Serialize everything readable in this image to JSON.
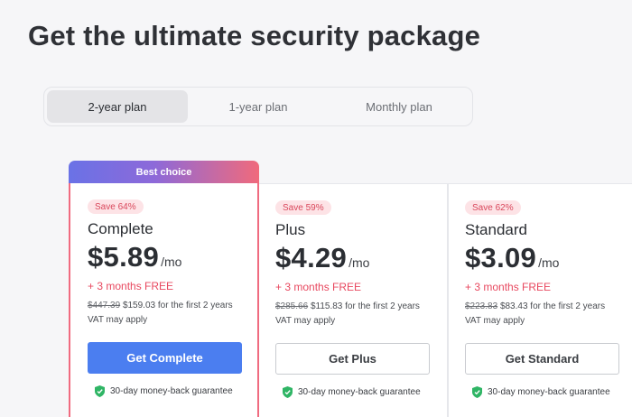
{
  "page": {
    "title": "Get the ultimate security package"
  },
  "plan_tabs": [
    {
      "label": "2-year plan",
      "active": true
    },
    {
      "label": "1-year plan",
      "active": false
    },
    {
      "label": "Monthly plan",
      "active": false
    }
  ],
  "cards": [
    {
      "banner": "Best choice",
      "save": "Save 64%",
      "name": "Complete",
      "price": "$5.89",
      "per": "/mo",
      "free": "+ 3 months FREE",
      "old_price": "$447.39",
      "new_price": "$159.03",
      "billing_suffix": " for the first 2 years",
      "vat": "VAT may apply",
      "cta": "Get Complete",
      "guarantee": "30-day money-back guarantee"
    },
    {
      "save": "Save 59%",
      "name": "Plus",
      "price": "$4.29",
      "per": "/mo",
      "free": "+ 3 months FREE",
      "old_price": "$285.66",
      "new_price": "$115.83",
      "billing_suffix": " for the first 2 years",
      "vat": "VAT may apply",
      "cta": "Get Plus",
      "guarantee": "30-day money-back guarantee"
    },
    {
      "save": "Save 62%",
      "name": "Standard",
      "price": "$3.09",
      "per": "/mo",
      "free": "+ 3 months FREE",
      "old_price": "$223.83",
      "new_price": "$83.43",
      "billing_suffix": " for the first 2 years",
      "vat": "VAT may apply",
      "cta": "Get Standard",
      "guarantee": "30-day money-back guarantee"
    }
  ],
  "colors": {
    "accent_blue": "#4b7ef0",
    "sale_red": "#e8485f",
    "badge_bg": "#fde3e6",
    "featured_border": "#f06b80",
    "shield_green": "#2fb565"
  },
  "icons": {
    "guarantee": "shield-check-icon"
  }
}
